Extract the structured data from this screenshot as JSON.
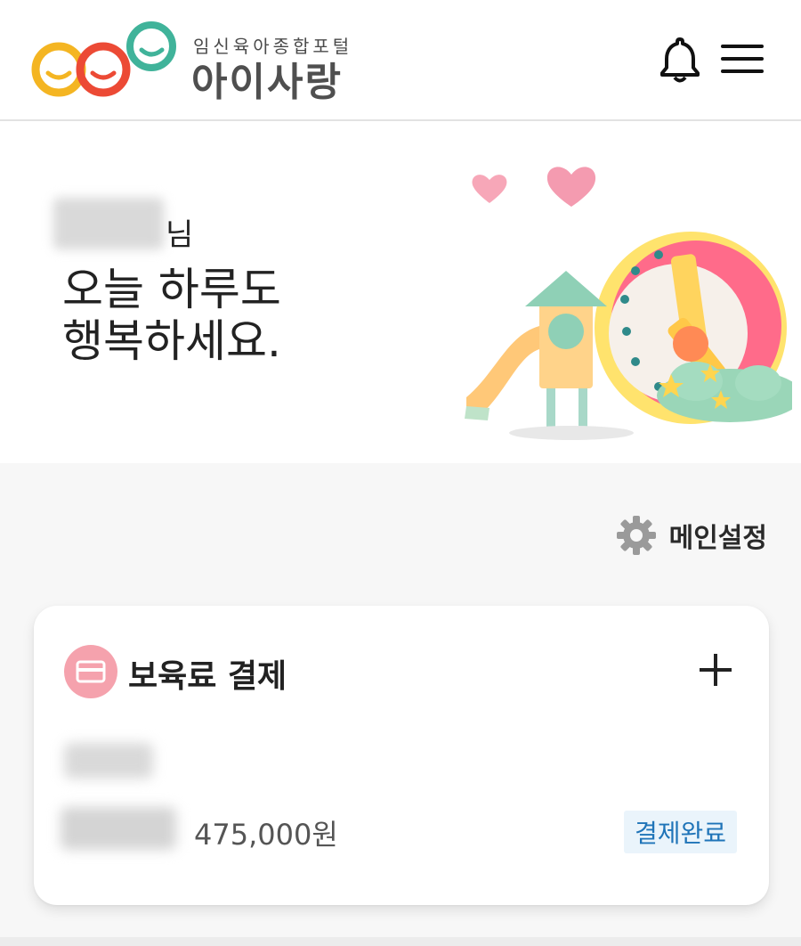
{
  "header": {
    "logo_subtitle": "임신육아종합포털",
    "logo_title": "아이사랑",
    "notification_icon": "bell-icon",
    "menu_icon": "hamburger-menu-icon"
  },
  "hero": {
    "name_suffix": "님",
    "greeting_line1": "오늘 하루도",
    "greeting_line2": "행복하세요."
  },
  "main_settings": {
    "label": "메인설정",
    "icon": "gear-icon"
  },
  "payment_card": {
    "title": "보육료 결제",
    "icon": "card-icon",
    "add_icon": "plus-icon",
    "amount": "475,000원",
    "status": "결제완료"
  },
  "colors": {
    "accent_pink": "#f5a2ad",
    "status_blue": "#1f74b8",
    "status_bg": "#eaf4fb",
    "page_bg": "#f7f7f7"
  }
}
